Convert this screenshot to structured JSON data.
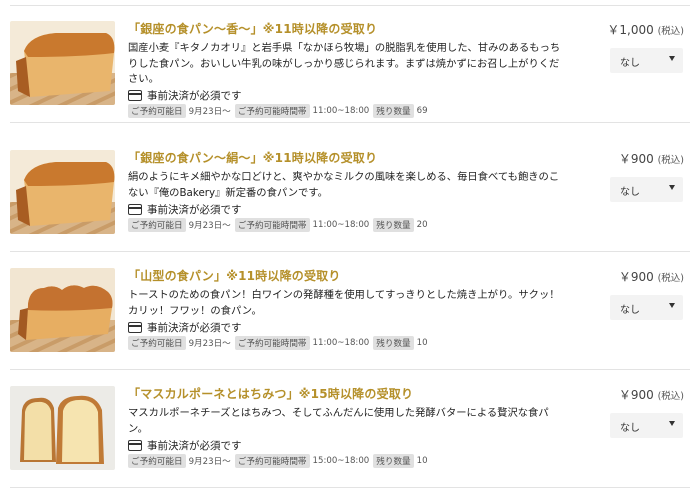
{
  "products": [
    {
      "image": "bread-loaf-square",
      "title": "「銀座の食パン～香～」※11時以降の受取り",
      "description": "国産小麦『キタノカオリ』と岩手県「なかほら牧場」の脱脂乳を使用した、甘みのあるもっちりした食パン。おいしい牛乳の味がしっかり感じられます。まずは焼かずにお召し上がりください。",
      "payment": "事前決済が必須です",
      "available_date_label": "ご予約可能日",
      "available_date": "9月23日～",
      "time_label": "ご予約可能時間帯",
      "time": "11:00~18:00",
      "stock_label": "残り数量",
      "stock": "69",
      "price": "￥1,000",
      "tax": "(税込)",
      "qty": "なし"
    },
    {
      "image": "bread-loaf-square",
      "title": "「銀座の食パン～絹～」※11時以降の受取り",
      "description": "絹のようにキメ細やかな口どけと、爽やかなミルクの風味を楽しめる、毎日食べても飽きのこない『俺のBakery』新定番の食パンです。",
      "payment": "事前決済が必須です",
      "available_date_label": "ご予約可能日",
      "available_date": "9月23日～",
      "time_label": "ご予約可能時間帯",
      "time": "11:00~18:00",
      "stock_label": "残り数量",
      "stock": "20",
      "price": "￥900",
      "tax": "(税込)",
      "qty": "なし"
    },
    {
      "image": "bread-loaf-mountain",
      "title": "「山型の食パン」※11時以降の受取り",
      "description": "トーストのための食パン！白ワインの発酵種を使用してすっきりとした焼き上がり。サクッ！カリッ！フワッ！の食パン。",
      "payment": "事前決済が必須です",
      "available_date_label": "ご予約可能日",
      "available_date": "9月23日～",
      "time_label": "ご予約可能時間帯",
      "time": "11:00~18:00",
      "stock_label": "残り数量",
      "stock": "10",
      "price": "￥900",
      "tax": "(税込)",
      "qty": "なし"
    },
    {
      "image": "bread-sliced",
      "title": "「マスカルポーネとはちみつ」※15時以降の受取り",
      "description": "マスカルポーネチーズとはちみつ、そしてふんだんに使用した発酵バターによる贅沢な食パン。",
      "payment": "事前決済が必須です",
      "available_date_label": "ご予約可能日",
      "available_date": "9月23日～",
      "time_label": "ご予約可能時間帯",
      "time": "15:00~18:00",
      "stock_label": "残り数量",
      "stock": "10",
      "price": "￥900",
      "tax": "(税込)",
      "qty": "なし"
    }
  ]
}
